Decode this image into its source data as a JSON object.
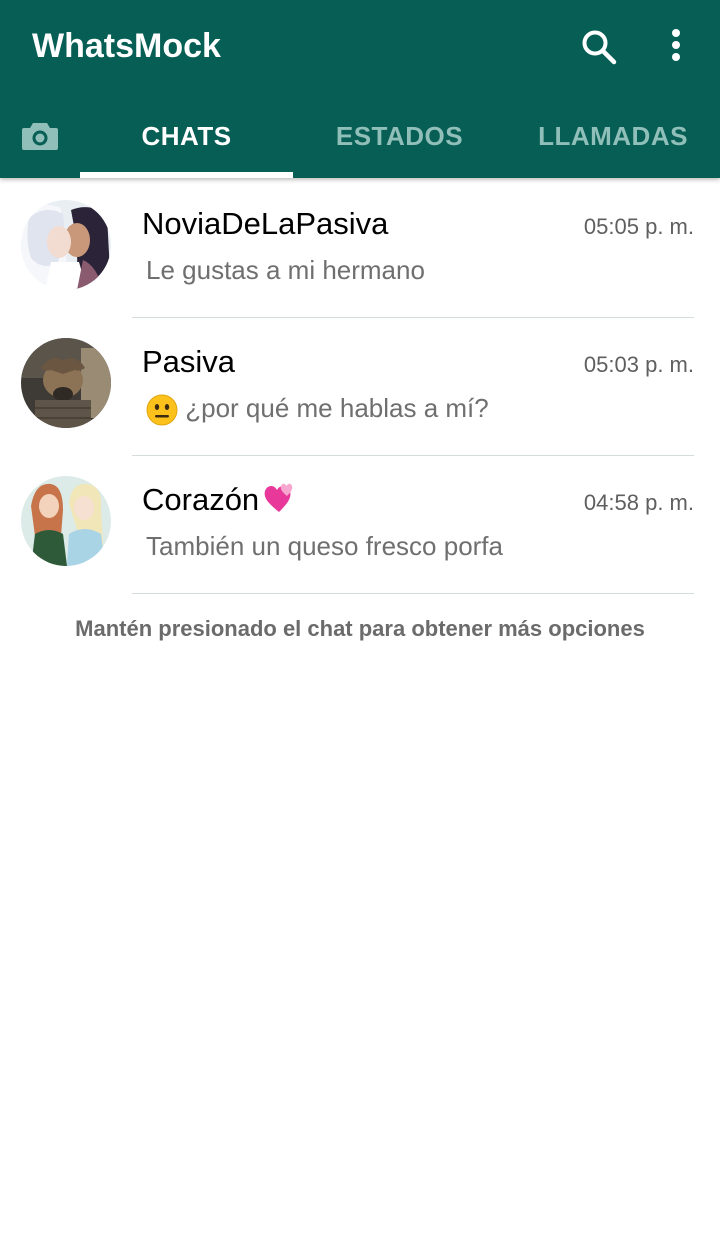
{
  "app": {
    "title": "WhatsMock"
  },
  "toolbar": {
    "search_icon": "search-icon",
    "more_icon": "more-vert-icon"
  },
  "tabs": [
    {
      "label": "CHATS",
      "selected": true
    },
    {
      "label": "ESTADOS",
      "selected": false
    },
    {
      "label": "LLAMADAS",
      "selected": false
    }
  ],
  "chats": [
    {
      "name": "NoviaDeLaPasiva",
      "time": "05:05 p. m.",
      "message": "Le gustas a mi hermano"
    },
    {
      "name": "Pasiva",
      "time": "05:03 p. m.",
      "message": "¿por qué me hablas a mí?",
      "message_emoji": "neutral-face"
    },
    {
      "name": "Corazón",
      "name_emoji": "two-hearts",
      "time": "04:58 p. m.",
      "message": "También un queso fresco porfa"
    }
  ],
  "footer_hint": "Mantén presionado el chat para obtener más opciones",
  "colors": {
    "header": "#075e54",
    "tab_inactive": "#8fbfb8",
    "tab_active": "#ffffff",
    "divider": "#d5dcdd"
  }
}
